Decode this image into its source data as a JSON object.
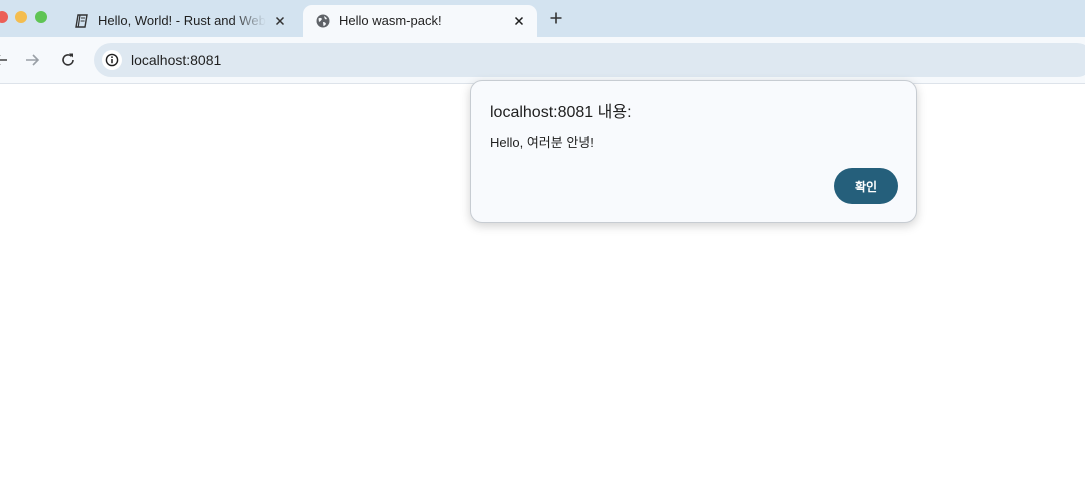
{
  "browser": {
    "tabs": [
      {
        "title": "Hello, World! - Rust and WebAssembly",
        "icon": "book-icon",
        "active": false
      },
      {
        "title": "Hello wasm-pack!",
        "icon": "globe-icon",
        "active": true
      }
    ],
    "address_bar": {
      "url": "localhost:8081",
      "icon": "info-icon"
    }
  },
  "dialog": {
    "title": "localhost:8081 내용:",
    "message": "Hello, 여러분 안녕!",
    "ok_label": "확인",
    "ok_color": "#255f7b"
  },
  "colors": {
    "tabstrip": "#d3e3f0",
    "toolbar": "#f6f9fc",
    "omnibox": "#dee8f1"
  }
}
